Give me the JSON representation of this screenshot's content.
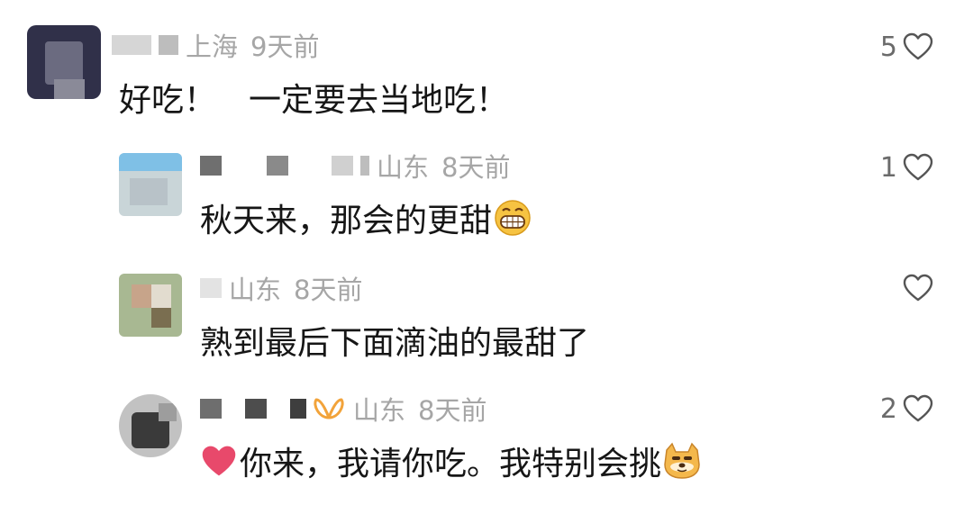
{
  "comments": [
    {
      "location": "上海",
      "time": "9天前",
      "text": "好吃！　一定要去当地吃！",
      "likes": "5"
    },
    {
      "location": "山东",
      "time": "8天前",
      "text": "秋天来，那会的更甜",
      "likes": "1",
      "emoji": "grinning-face-emoji"
    },
    {
      "location": "山东",
      "time": "8天前",
      "text": "熟到最后下面滴油的最甜了",
      "likes": ""
    },
    {
      "location": "山东",
      "time": "8天前",
      "text": "你来，我请你吃。我特别会挑",
      "likes": "2",
      "lead_emoji": "heart-emoji",
      "emoji": "doge-emoji",
      "badge": "fan-badge-icon"
    }
  ],
  "colors": {
    "meta_text": "#a6a6a6",
    "body_text": "#161616",
    "badge": "#f2a33a",
    "heart_emoji": "#e8496b"
  }
}
